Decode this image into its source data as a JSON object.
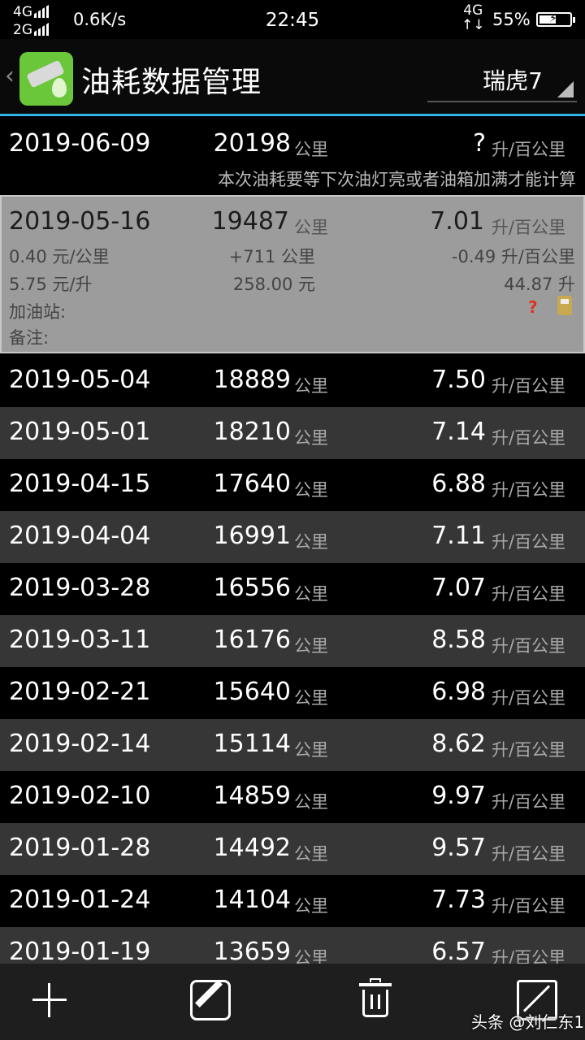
{
  "status": {
    "sig1": "4G",
    "sig2": "2G",
    "speed": "0.6K/s",
    "time": "22:45",
    "net": "4G",
    "battery_pct": "55%",
    "battery_level": 0.55
  },
  "appbar": {
    "title": "油耗数据管理",
    "car": "瑞虎7"
  },
  "units": {
    "km": "公里",
    "cons": "升/百公里"
  },
  "first": {
    "date": "2019-06-09",
    "km": "20198",
    "cons": "?",
    "note": "本次油耗要等下次油灯亮或者油箱加满才能计算"
  },
  "selected": {
    "date": "2019-05-16",
    "km": "19487",
    "cons": "7.01",
    "cost_per_km": "0.40 元/公里",
    "km_delta": "+711 公里",
    "cons_delta": "-0.49 升/百公里",
    "price": "5.75 元/升",
    "amount": "258.00 元",
    "liters": "44.87 升",
    "station": "加油站:",
    "remark": "备注:",
    "flag": "?"
  },
  "rows": [
    {
      "date": "2019-05-04",
      "km": "18889",
      "cons": "7.50"
    },
    {
      "date": "2019-05-01",
      "km": "18210",
      "cons": "7.14"
    },
    {
      "date": "2019-04-15",
      "km": "17640",
      "cons": "6.88"
    },
    {
      "date": "2019-04-04",
      "km": "16991",
      "cons": "7.11"
    },
    {
      "date": "2019-03-28",
      "km": "16556",
      "cons": "7.07"
    },
    {
      "date": "2019-03-11",
      "km": "16176",
      "cons": "8.58"
    },
    {
      "date": "2019-02-21",
      "km": "15640",
      "cons": "6.98"
    },
    {
      "date": "2019-02-14",
      "km": "15114",
      "cons": "8.62"
    },
    {
      "date": "2019-02-10",
      "km": "14859",
      "cons": "9.97"
    },
    {
      "date": "2019-01-28",
      "km": "14492",
      "cons": "9.57"
    },
    {
      "date": "2019-01-24",
      "km": "14104",
      "cons": "7.73"
    },
    {
      "date": "2019-01-19",
      "km": "13659",
      "cons": "6.57"
    }
  ],
  "watermark": "头条 @刘仁东1"
}
